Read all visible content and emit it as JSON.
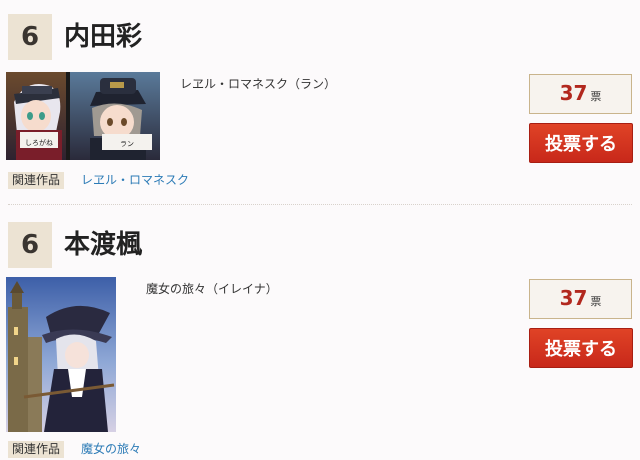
{
  "entries": [
    {
      "rank": "6",
      "name": "内田彩",
      "role": "レヱル・ロマネスク（ラン）",
      "votes": "37",
      "vote_unit": "票",
      "vote_button": "投票する",
      "related_label": "関連作品",
      "related_work": "レヱル・ロマネスク",
      "card_texts": [
        "しろがね",
        "ラン"
      ]
    },
    {
      "rank": "6",
      "name": "本渡楓",
      "role": "魔女の旅々（イレイナ）",
      "votes": "37",
      "vote_unit": "票",
      "vote_button": "投票する",
      "related_label": "関連作品",
      "related_work": "魔女の旅々"
    }
  ]
}
